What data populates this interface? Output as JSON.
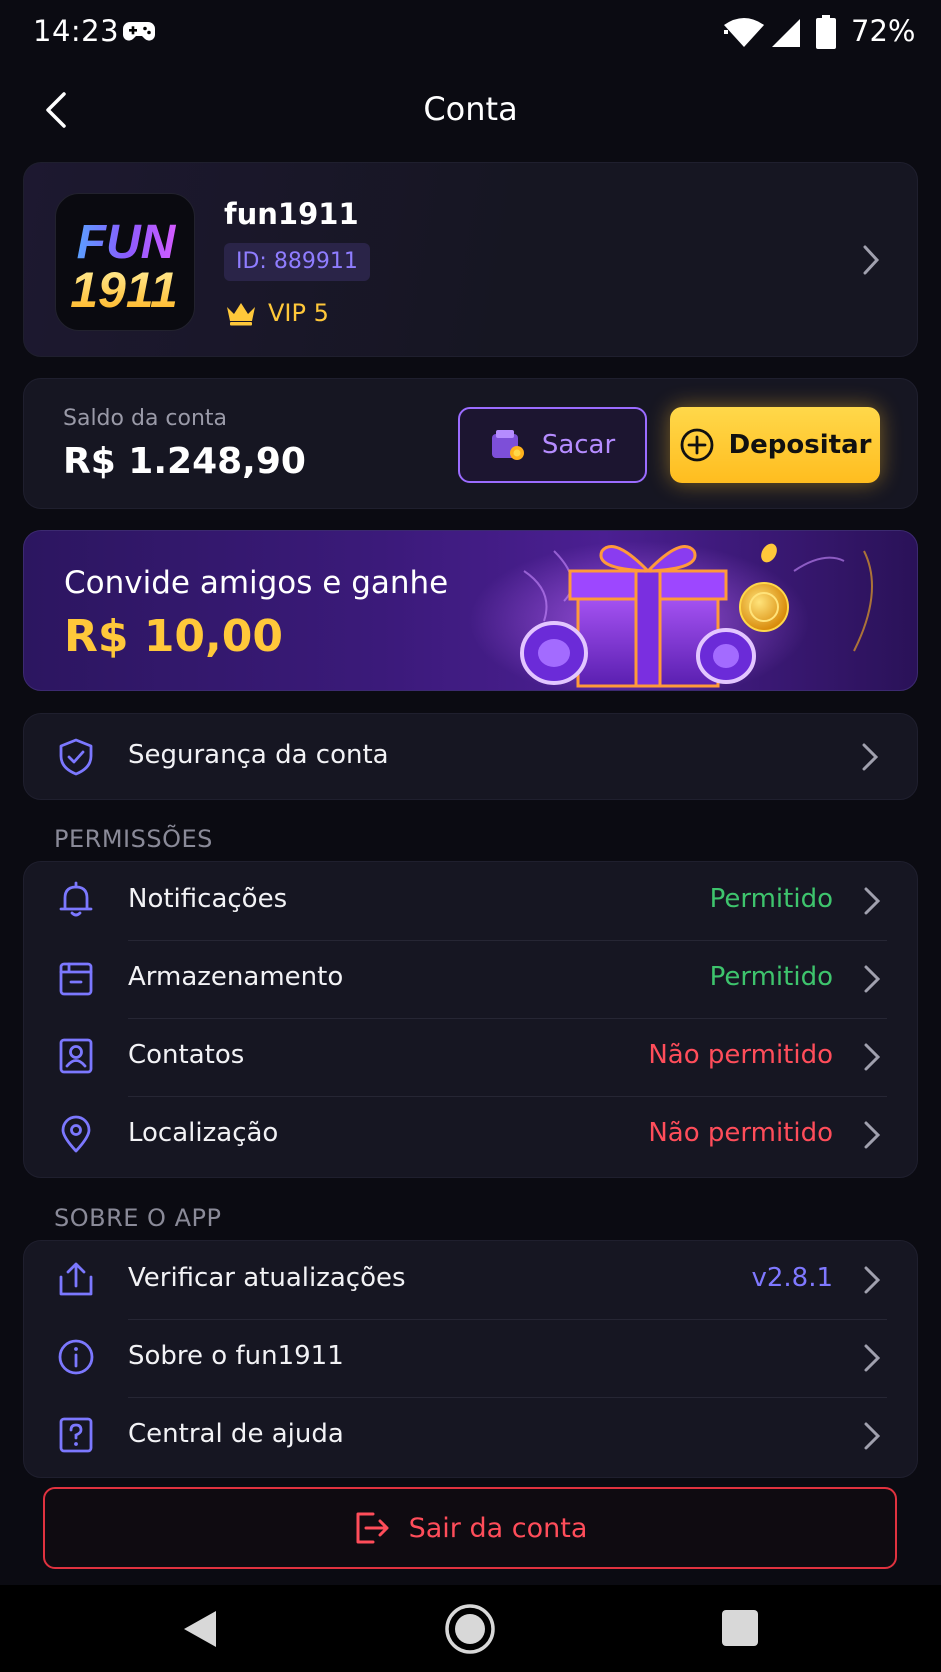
{
  "status_bar": {
    "time": "14:23",
    "battery": "72%"
  },
  "header": {
    "title": "Conta"
  },
  "profile": {
    "logo_text_top": "FUN",
    "logo_text_bottom": "1911",
    "username": "fun1911",
    "id": "ID: 889911",
    "vip": "VIP 5"
  },
  "balance": {
    "label": "Saldo da conta",
    "value": "R$ 1.248,90",
    "withdraw_label": "Sacar",
    "deposit_label": "Depositar"
  },
  "banner": {
    "title": "Convide amigos e ganhe",
    "amount": "R$ 10,00"
  },
  "security": {
    "label": "Segurança da conta"
  },
  "permissions": {
    "section_title": "PERMISSÕES",
    "items": [
      {
        "label": "Notificações",
        "status": "Permitido"
      },
      {
        "label": "Armazenamento",
        "status": "Permitido"
      },
      {
        "label": "Contatos",
        "status": "Não permitido"
      },
      {
        "label": "Localização",
        "status": "Não permitido"
      }
    ]
  },
  "about": {
    "section_title": "SOBRE O APP",
    "items": [
      {
        "label": "Verificar atualizações",
        "value": "v2.8.1"
      },
      {
        "label": "Sobre o fun1911"
      },
      {
        "label": "Central de ajuda"
      }
    ]
  },
  "logout": {
    "label": "Sair da conta"
  },
  "colors": {
    "background": "#0b0b12",
    "card": "#161622",
    "accent_purple": "#9b6cff",
    "accent_gold": "#ffc83a",
    "allowed": "#3ec46d",
    "denied": "#ff4d5a",
    "version": "#7f78ff"
  }
}
